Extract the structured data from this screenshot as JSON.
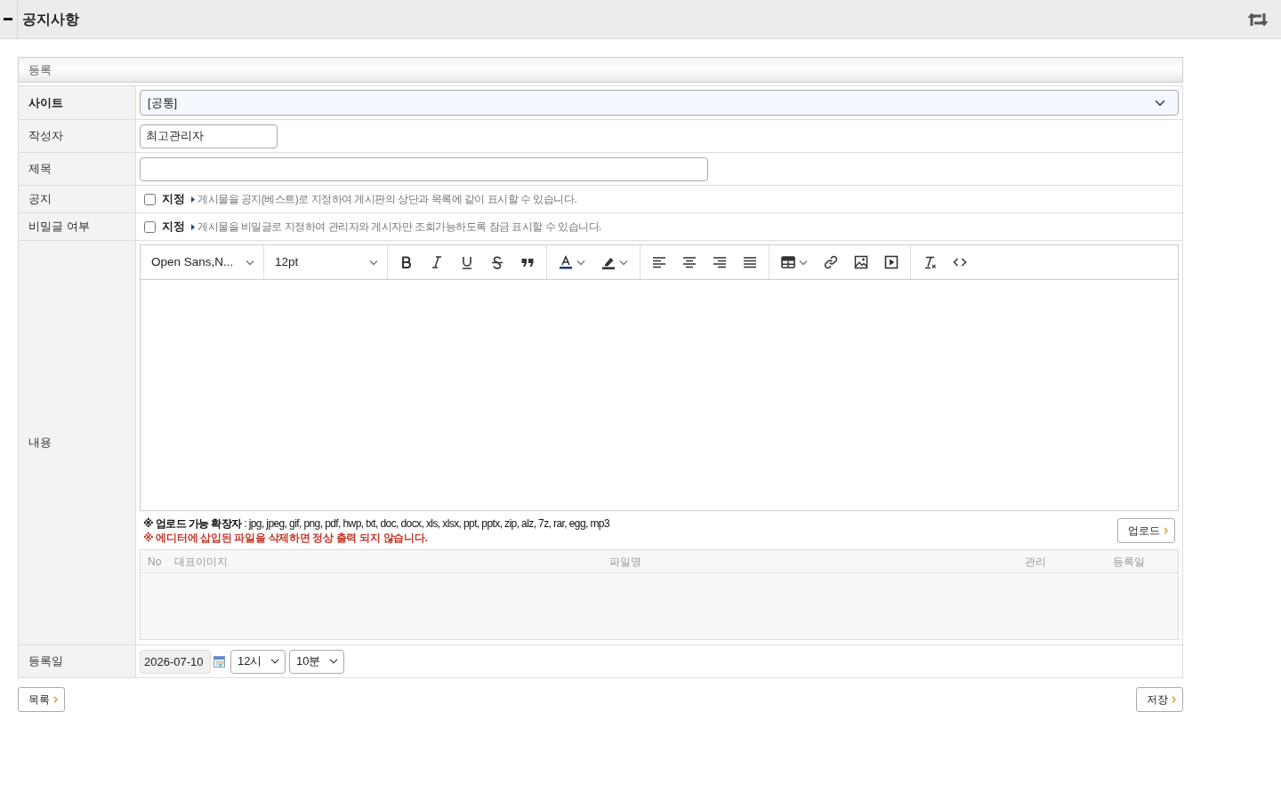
{
  "header": {
    "title": "공지사항"
  },
  "form": {
    "title": "등록",
    "rows": [
      {
        "kind": "select",
        "label": "사이트",
        "required": true,
        "value": "[공통]"
      },
      {
        "kind": "shortfield",
        "label": "작성자",
        "required": false,
        "value": "최고관리자"
      },
      {
        "kind": "field",
        "label": "제목",
        "required": false
      },
      {
        "kind": "checkbox",
        "label": "공지",
        "required": false,
        "checked": false,
        "option": "지정",
        "hint": "게시물을 공지(베스트)로 지정하여 게시판의 상단과 목록에 같이 표시할 수 있습니다."
      },
      {
        "kind": "checkbox",
        "label": "비밀글 여부",
        "required": false,
        "checked": false,
        "option": "지정",
        "hint": "게시물을 비밀글로 지정하여 관리자와 게시자만 조회가능하도록 잠금 표시할 수 있습니다."
      },
      {
        "kind": "editor",
        "label": "내용",
        "required": false,
        "toolbar": {
          "font_select": "Open Sans,N...",
          "size_select": "12pt"
        },
        "upload": {
          "note": "**※ 업로드 가능 확장자** : jpg, jpeg, gif, png, pdf, hwp, txt, doc, docx, xls, xlsx, ppt, pptx, zip, alz, 7z, rar, egg, mp3",
          "warning": "※ 에디터에 삽입된 파일을 삭제하면 정상 출력 되지 않습니다.",
          "button": "업로드"
        },
        "files": {
          "columns": [
            "No",
            "대표이미지",
            "파일명",
            "관리",
            "등록일"
          ]
        }
      },
      {
        "kind": "datetime",
        "label": "등록일",
        "required": false,
        "date": "2026-07-10",
        "hour": "12시",
        "minute": "10분"
      }
    ]
  },
  "footer": {
    "list_button": "목록",
    "save_button": "저장"
  }
}
